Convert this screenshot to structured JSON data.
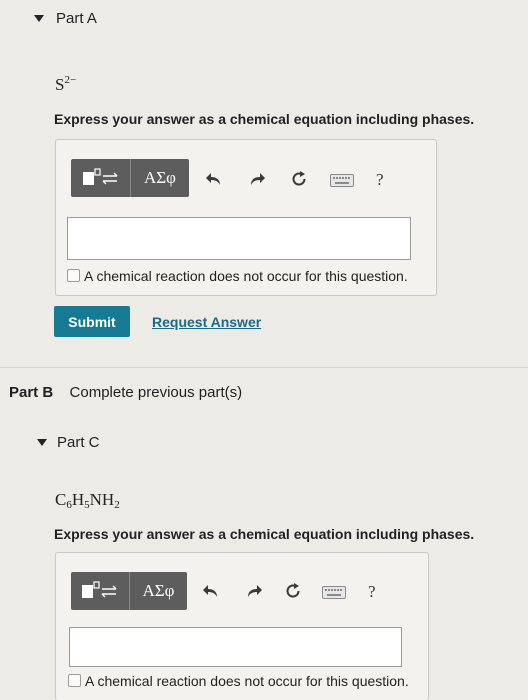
{
  "part_a": {
    "title": "Part A",
    "formula_base": "S",
    "formula_charge": "2−",
    "prompt": "Express your answer as a chemical equation including phases.",
    "toolbar": {
      "greek_label": "ΑΣφ",
      "help_label": "?"
    },
    "input_value": "",
    "no_reaction_label": "A chemical reaction does not occur for this question.",
    "submit_label": "Submit",
    "request_answer_label": "Request Answer"
  },
  "part_b": {
    "title": "Part B",
    "status": "Complete previous part(s)"
  },
  "part_c": {
    "title": "Part C",
    "formula": {
      "c": "C",
      "c_sub": "6",
      "h": "H",
      "h_sub": "5",
      "n": "NH",
      "n_sub": "2"
    },
    "prompt": "Express your answer as a chemical equation including phases.",
    "toolbar": {
      "greek_label": "ΑΣφ",
      "help_label": "?"
    },
    "input_value": "",
    "no_reaction_label": "A chemical reaction does not occur for this question."
  }
}
